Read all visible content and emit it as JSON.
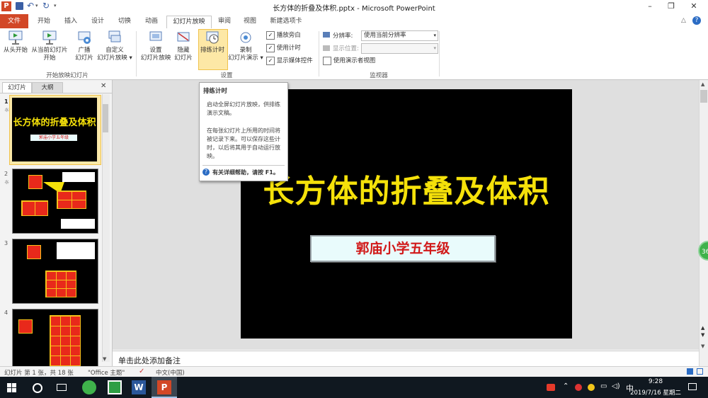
{
  "window": {
    "title": "长方体的折叠及体积.pptx - Microsoft PowerPoint",
    "controls": [
      "–",
      "❐",
      "✕"
    ]
  },
  "quick_access": {
    "app_icon": "P"
  },
  "tabs": [
    "文件",
    "开始",
    "插入",
    "设计",
    "切换",
    "动画",
    "幻灯片放映",
    "审阅",
    "视图",
    "新建选项卡"
  ],
  "ribbon": {
    "start_group": {
      "label": "开始放映幻灯片",
      "buttons": [
        {
          "line1": "从头开始",
          "line2": ""
        },
        {
          "line1": "从当前幻灯片",
          "line2": "开始"
        },
        {
          "line1": "广播",
          "line2": "幻灯片"
        },
        {
          "line1": "自定义",
          "line2": "幻灯片放映 ▾"
        }
      ]
    },
    "setup_group": {
      "label": "设置",
      "buttons": [
        {
          "line1": "设置",
          "line2": "幻灯片放映"
        },
        {
          "line1": "隐藏",
          "line2": "幻灯片"
        },
        {
          "line1": "排练计时",
          "line2": ""
        },
        {
          "line1": "录制",
          "line2": "幻灯片演示 ▾"
        }
      ],
      "checkboxes": [
        {
          "label": "播放旁白",
          "checked": true
        },
        {
          "label": "使用计时",
          "checked": true
        },
        {
          "label": "显示媒体控件",
          "checked": true
        }
      ]
    },
    "monitor_group": {
      "label": "监视器",
      "resolution_label": "分辨率:",
      "resolution_value": "使用当前分辨率",
      "show_on_label": "显示位置:",
      "show_on_value": "",
      "presenter_view_label": "使用演示者视图",
      "checkmark": "✓"
    }
  },
  "left_pane": {
    "tabs": [
      "幻灯片",
      "大纲"
    ],
    "close": "✕",
    "thumbnails": [
      {
        "number": "1",
        "mark": "☼",
        "title": "长方体的折叠及体积",
        "subtitle": "郭庙小学五年级"
      },
      {
        "number": "2",
        "mark": "☼"
      },
      {
        "number": "3",
        "mark": ""
      },
      {
        "number": "4",
        "mark": ""
      }
    ]
  },
  "slide": {
    "title": "长方体的折叠及体积",
    "subtitle": "郭庙小学五年级",
    "title_color": "#f5e10a",
    "subtitle_color": "#d11a1a"
  },
  "tooltip": {
    "title": "排练计时",
    "desc1": "启动全屏幻灯片放映，供排练演示文稿。",
    "desc2": "在每张幻灯片上所用的时间将被记录下来。可以保存这些计时，以后将其用于自动运行放映。",
    "help": "有关详细帮助，请按 F1。"
  },
  "notes_placeholder": "单击此处添加备注",
  "side_badge": "36",
  "status": {
    "slide_info": "幻灯片 第 1 张，共 18 张",
    "theme": "\"Office 主题\"",
    "language": "中文(中国)"
  },
  "taskbar": {
    "time": "9:28",
    "date": "2019/7/16 星期二",
    "ime": "中",
    "app_labels": [
      "W",
      "P"
    ]
  },
  "colors": {
    "file_tab": "#d24726",
    "accent": "#f5c21b",
    "cube_red": "#e8291b"
  }
}
